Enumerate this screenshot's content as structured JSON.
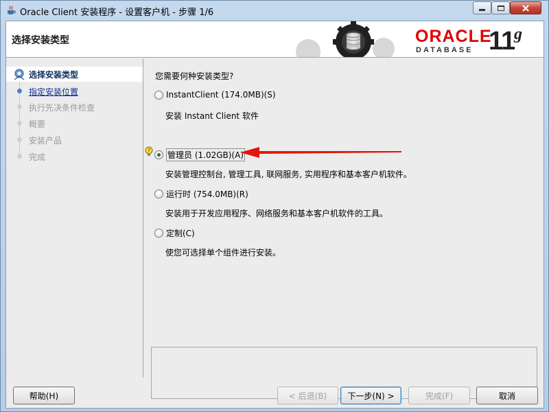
{
  "window": {
    "title": "Oracle Client 安装程序 - 设置客户机 - 步骤 1/6",
    "icons": {
      "app": "java-icon",
      "minimize": "minimize-icon",
      "maximize": "maximize-icon",
      "close": "close-icon"
    }
  },
  "banner": {
    "title": "选择安装类型",
    "brand": {
      "name": "ORACLE",
      "product": "DATABASE",
      "version": "11",
      "version_suffix": "g",
      "color": "#e10000"
    }
  },
  "nav": {
    "items": [
      {
        "label": "选择安装类型",
        "state": "current"
      },
      {
        "label": "指定安装位置",
        "state": "link"
      },
      {
        "label": "执行先决条件检查",
        "state": "disabled"
      },
      {
        "label": "概要",
        "state": "disabled"
      },
      {
        "label": "安装产品",
        "state": "disabled"
      },
      {
        "label": "完成",
        "state": "disabled"
      }
    ]
  },
  "main": {
    "question": "您需要何种安装类型?",
    "options": [
      {
        "label": "InstantClient (174.0MB)(S)",
        "description": "安装 Instant Client 软件",
        "selected": false
      },
      {
        "label": "管理员 (1.02GB)(A)",
        "description": "安装管理控制台, 管理工具, 联网服务, 实用程序和基本客户机软件。",
        "selected": true
      },
      {
        "label": "运行时 (754.0MB)(R)",
        "description": "安装用于开发应用程序、网络服务和基本客户机软件的工具。",
        "selected": false
      },
      {
        "label": "定制(C)",
        "description": "使您可选择单个组件进行安装。",
        "selected": false
      }
    ],
    "annotation_color": "#e3170a",
    "hint_icon": "lightbulb-icon"
  },
  "buttons": {
    "help": "帮助(H)",
    "back": "< 后退(B)",
    "next": "下一步(N) >",
    "finish": "完成(F)",
    "cancel": "取消"
  }
}
